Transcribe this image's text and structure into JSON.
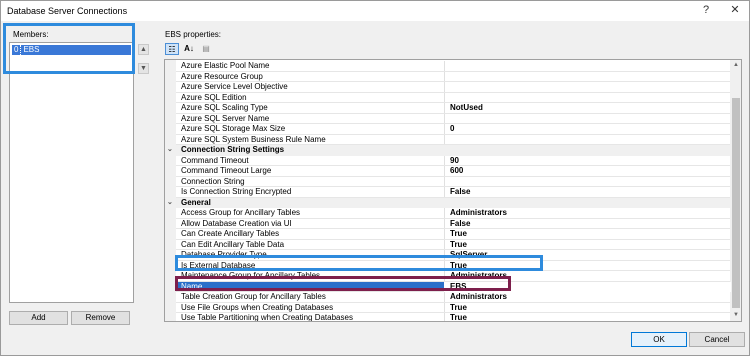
{
  "window": {
    "title": "Database Server Connections",
    "help_label": "?",
    "close_label": "✕"
  },
  "members": {
    "label": "Members:",
    "items": [
      {
        "index": "0",
        "name": "EBS"
      }
    ],
    "up_label": "▲",
    "down_label": "▼",
    "add_label": "Add",
    "remove_label": "Remove"
  },
  "properties": {
    "label": "EBS properties:",
    "toolbar": {
      "categorized_icon": "categorized-icon",
      "categorized_glyph": "☷",
      "alphabetical_icon": "sort-az-icon",
      "alphabetical_glyph": "A↓",
      "pages_icon": "property-pages-icon",
      "pages_glyph": "▤"
    },
    "rows": [
      {
        "kind": "prop",
        "name": "Azure Elastic Pool Name",
        "value": ""
      },
      {
        "kind": "prop",
        "name": "Azure Resource Group",
        "value": ""
      },
      {
        "kind": "prop",
        "name": "Azure Service Level Objective",
        "value": ""
      },
      {
        "kind": "prop",
        "name": "Azure SQL Edition",
        "value": ""
      },
      {
        "kind": "prop",
        "name": "Azure SQL Scaling Type",
        "value": "NotUsed"
      },
      {
        "kind": "prop",
        "name": "Azure SQL Server Name",
        "value": ""
      },
      {
        "kind": "prop",
        "name": "Azure SQL Storage Max Size",
        "value": "0"
      },
      {
        "kind": "prop",
        "name": "Azure SQL System Business Rule Name",
        "value": ""
      },
      {
        "kind": "cat",
        "name": "Connection String Settings"
      },
      {
        "kind": "prop",
        "name": "Command Timeout",
        "value": "90"
      },
      {
        "kind": "prop",
        "name": "Command Timeout Large",
        "value": "600"
      },
      {
        "kind": "prop",
        "name": "Connection String",
        "value": ""
      },
      {
        "kind": "prop",
        "name": "Is Connection String Encrypted",
        "value": "False"
      },
      {
        "kind": "cat",
        "name": "General"
      },
      {
        "kind": "prop",
        "name": "Access Group for Ancillary Tables",
        "value": "Administrators"
      },
      {
        "kind": "prop",
        "name": "Allow Database Creation via UI",
        "value": "False"
      },
      {
        "kind": "prop",
        "name": "Can Create Ancillary Tables",
        "value": "True"
      },
      {
        "kind": "prop",
        "name": "Can Edit Ancillary Table Data",
        "value": "True"
      },
      {
        "kind": "prop",
        "name": "Database Provider Type",
        "value": "SqlServer"
      },
      {
        "kind": "prop",
        "name": "Is External Database",
        "value": "True"
      },
      {
        "kind": "prop",
        "name": "Maintenance Group for Ancillary Tables",
        "value": "Administrators"
      },
      {
        "kind": "prop",
        "name": "Name",
        "value": "EBS",
        "selected": true
      },
      {
        "kind": "prop",
        "name": "Table Creation Group for Ancillary Tables",
        "value": "Administrators"
      },
      {
        "kind": "prop",
        "name": "Use File Groups when Creating Databases",
        "value": "True"
      },
      {
        "kind": "prop",
        "name": "Use Table Partitioning when Creating Databases",
        "value": "True"
      }
    ],
    "collapse_glyph": "⌄"
  },
  "footer": {
    "ok_label": "OK",
    "cancel_label": "Cancel",
    "cut_off_text": "*********"
  },
  "colors": {
    "annotation_blue": "#2e8bdd",
    "annotation_purple": "#7d1f4c",
    "selection_blue": "#2a6fc9"
  }
}
